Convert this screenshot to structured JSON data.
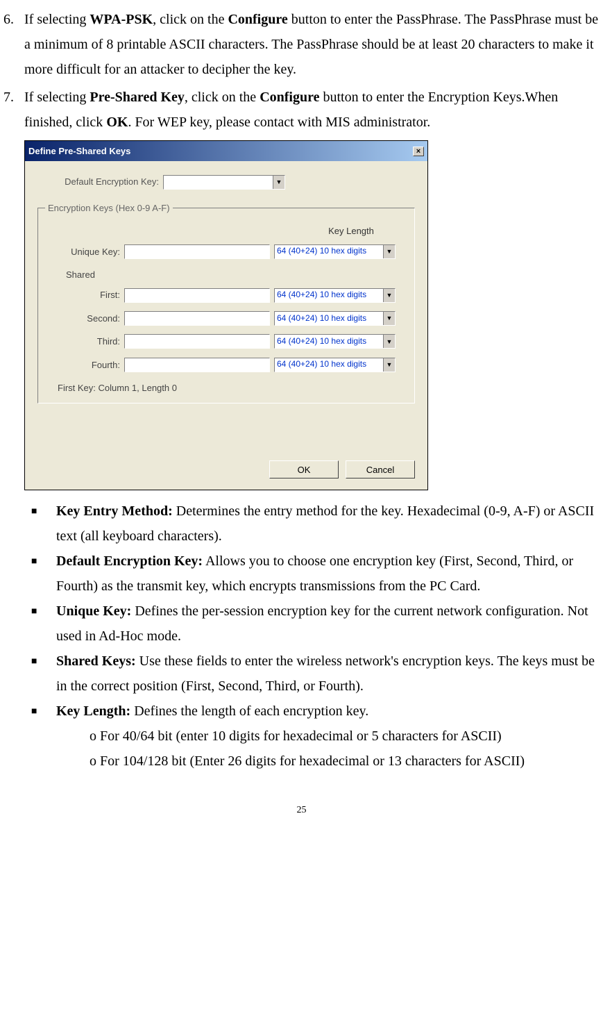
{
  "items": {
    "six": {
      "num": "6.",
      "text_before": "If selecting ",
      "bold1": "WPA-PSK",
      "text_mid": ", click on the ",
      "bold2": "Configure",
      "text_after": " button to enter the PassPhrase. The PassPhrase must be a minimum of 8 printable ASCII characters. The PassPhrase should be at least 20 characters to make it more difficult for an attacker to decipher the key."
    },
    "seven": {
      "num": "7.",
      "text_before": "If selecting ",
      "bold1": "Pre-Shared Key",
      "text_mid": ", click on the ",
      "bold2": "Configure",
      "text_mid2": " button to enter the Encryption Keys.When finished, click ",
      "bold3": "OK",
      "text_after": ". For WEP key, please contact with MIS administrator."
    }
  },
  "dialog": {
    "title": "Define Pre-Shared Keys",
    "close": "×",
    "default_label": "Default Encryption Key:",
    "fieldset_legend": "Encryption Keys (Hex 0-9 A-F)",
    "key_length_header": "Key Length",
    "rows": {
      "unique": "Unique Key:",
      "shared": "Shared",
      "first": "First:",
      "second": "Second:",
      "third": "Third:",
      "fourth": "Fourth:"
    },
    "dropdown_value": "64  (40+24)  10 hex digits",
    "status": "First Key: Column 1,  Length 0",
    "ok": "OK",
    "cancel": "Cancel"
  },
  "bullets": {
    "key_entry": {
      "title": "Key Entry Method:",
      "text": " Determines the entry method for the key. Hexadecimal (0-9, A-F) or ASCII text (all keyboard characters)."
    },
    "default_enc": {
      "title": "Default Encryption Key:",
      "text": " Allows you to choose one encryption key (First, Second, Third, or Fourth) as the transmit key, which encrypts transmissions from the PC Card."
    },
    "unique_key": {
      "title": "Unique Key:",
      "text": " Defines the per-session encryption key for the current network configuration. Not used in Ad-Hoc mode."
    },
    "shared_keys": {
      "title": "Shared Keys:",
      "text": " Use these fields to enter the wireless network's encryption keys. The keys must be in the correct position (First, Second, Third, or Fourth)."
    },
    "key_length": {
      "title": "Key Length:",
      "text": " Defines the length of each encryption key.",
      "sub1": "o For 40/64 bit (enter 10 digits for hexadecimal or 5 characters for ASCII)",
      "sub2": "o For 104/128 bit (Enter 26 digits for hexadecimal or 13 characters for ASCII)"
    }
  },
  "page_number": "25"
}
